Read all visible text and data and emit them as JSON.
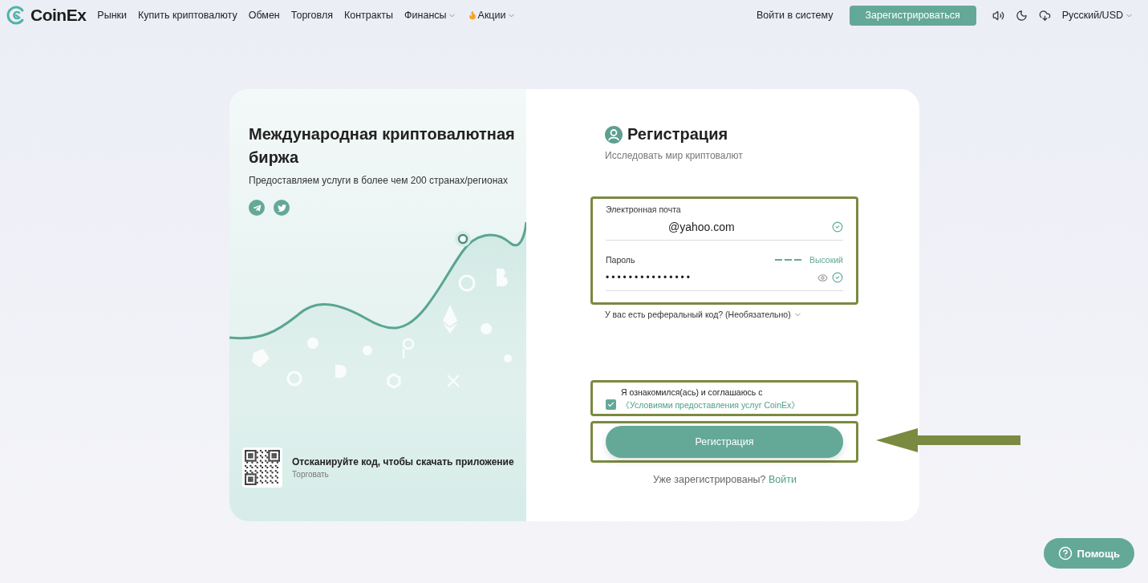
{
  "nav": {
    "logo": "CoinEx",
    "links": [
      {
        "label": "Рынки",
        "dropdown": false,
        "kind": "plain"
      },
      {
        "label": "Купить криптовалюту",
        "dropdown": false,
        "kind": "plain"
      },
      {
        "label": "Обмен",
        "dropdown": false,
        "kind": "plain"
      },
      {
        "label": "Торговля",
        "dropdown": false,
        "kind": "plain"
      },
      {
        "label": "Контракты",
        "dropdown": false,
        "kind": "plain"
      },
      {
        "label": "Финансы",
        "dropdown": true,
        "kind": "plain"
      },
      {
        "label": "Акции",
        "dropdown": true,
        "kind": "promo"
      }
    ],
    "login": "Войти в систему",
    "signup": "Зарегистрироваться",
    "language": "Русский/USD"
  },
  "promo": {
    "title": "Международная криптовалютная биржа",
    "subtitle": "Предоставляем услуги в более чем 200 странах/регионах",
    "app_title": "Отсканируйте код, чтобы скачать приложение",
    "app_caption": "Торговать"
  },
  "form": {
    "title": "Регистрация",
    "subtitle": "Исследовать мир криптовалют",
    "email": {
      "label": "Электронная почта",
      "value": "@yahoo.com",
      "valid": true
    },
    "password": {
      "label": "Пароль",
      "value": "•••••••••••••••",
      "strength": "Высокий",
      "level": 1,
      "valid": true
    },
    "referral": "У вас есть реферальный код? (Необязательно)",
    "terms": {
      "text": "Я ознакомился(ась) и соглашаюсь с",
      "link": "《Условиями предоставления услуг CoinEx》",
      "checked": true
    },
    "submit": "Регистрация",
    "login_prompt": "Уже зарегистрированы?",
    "login_link": "Войти"
  },
  "help": "Помощь"
}
